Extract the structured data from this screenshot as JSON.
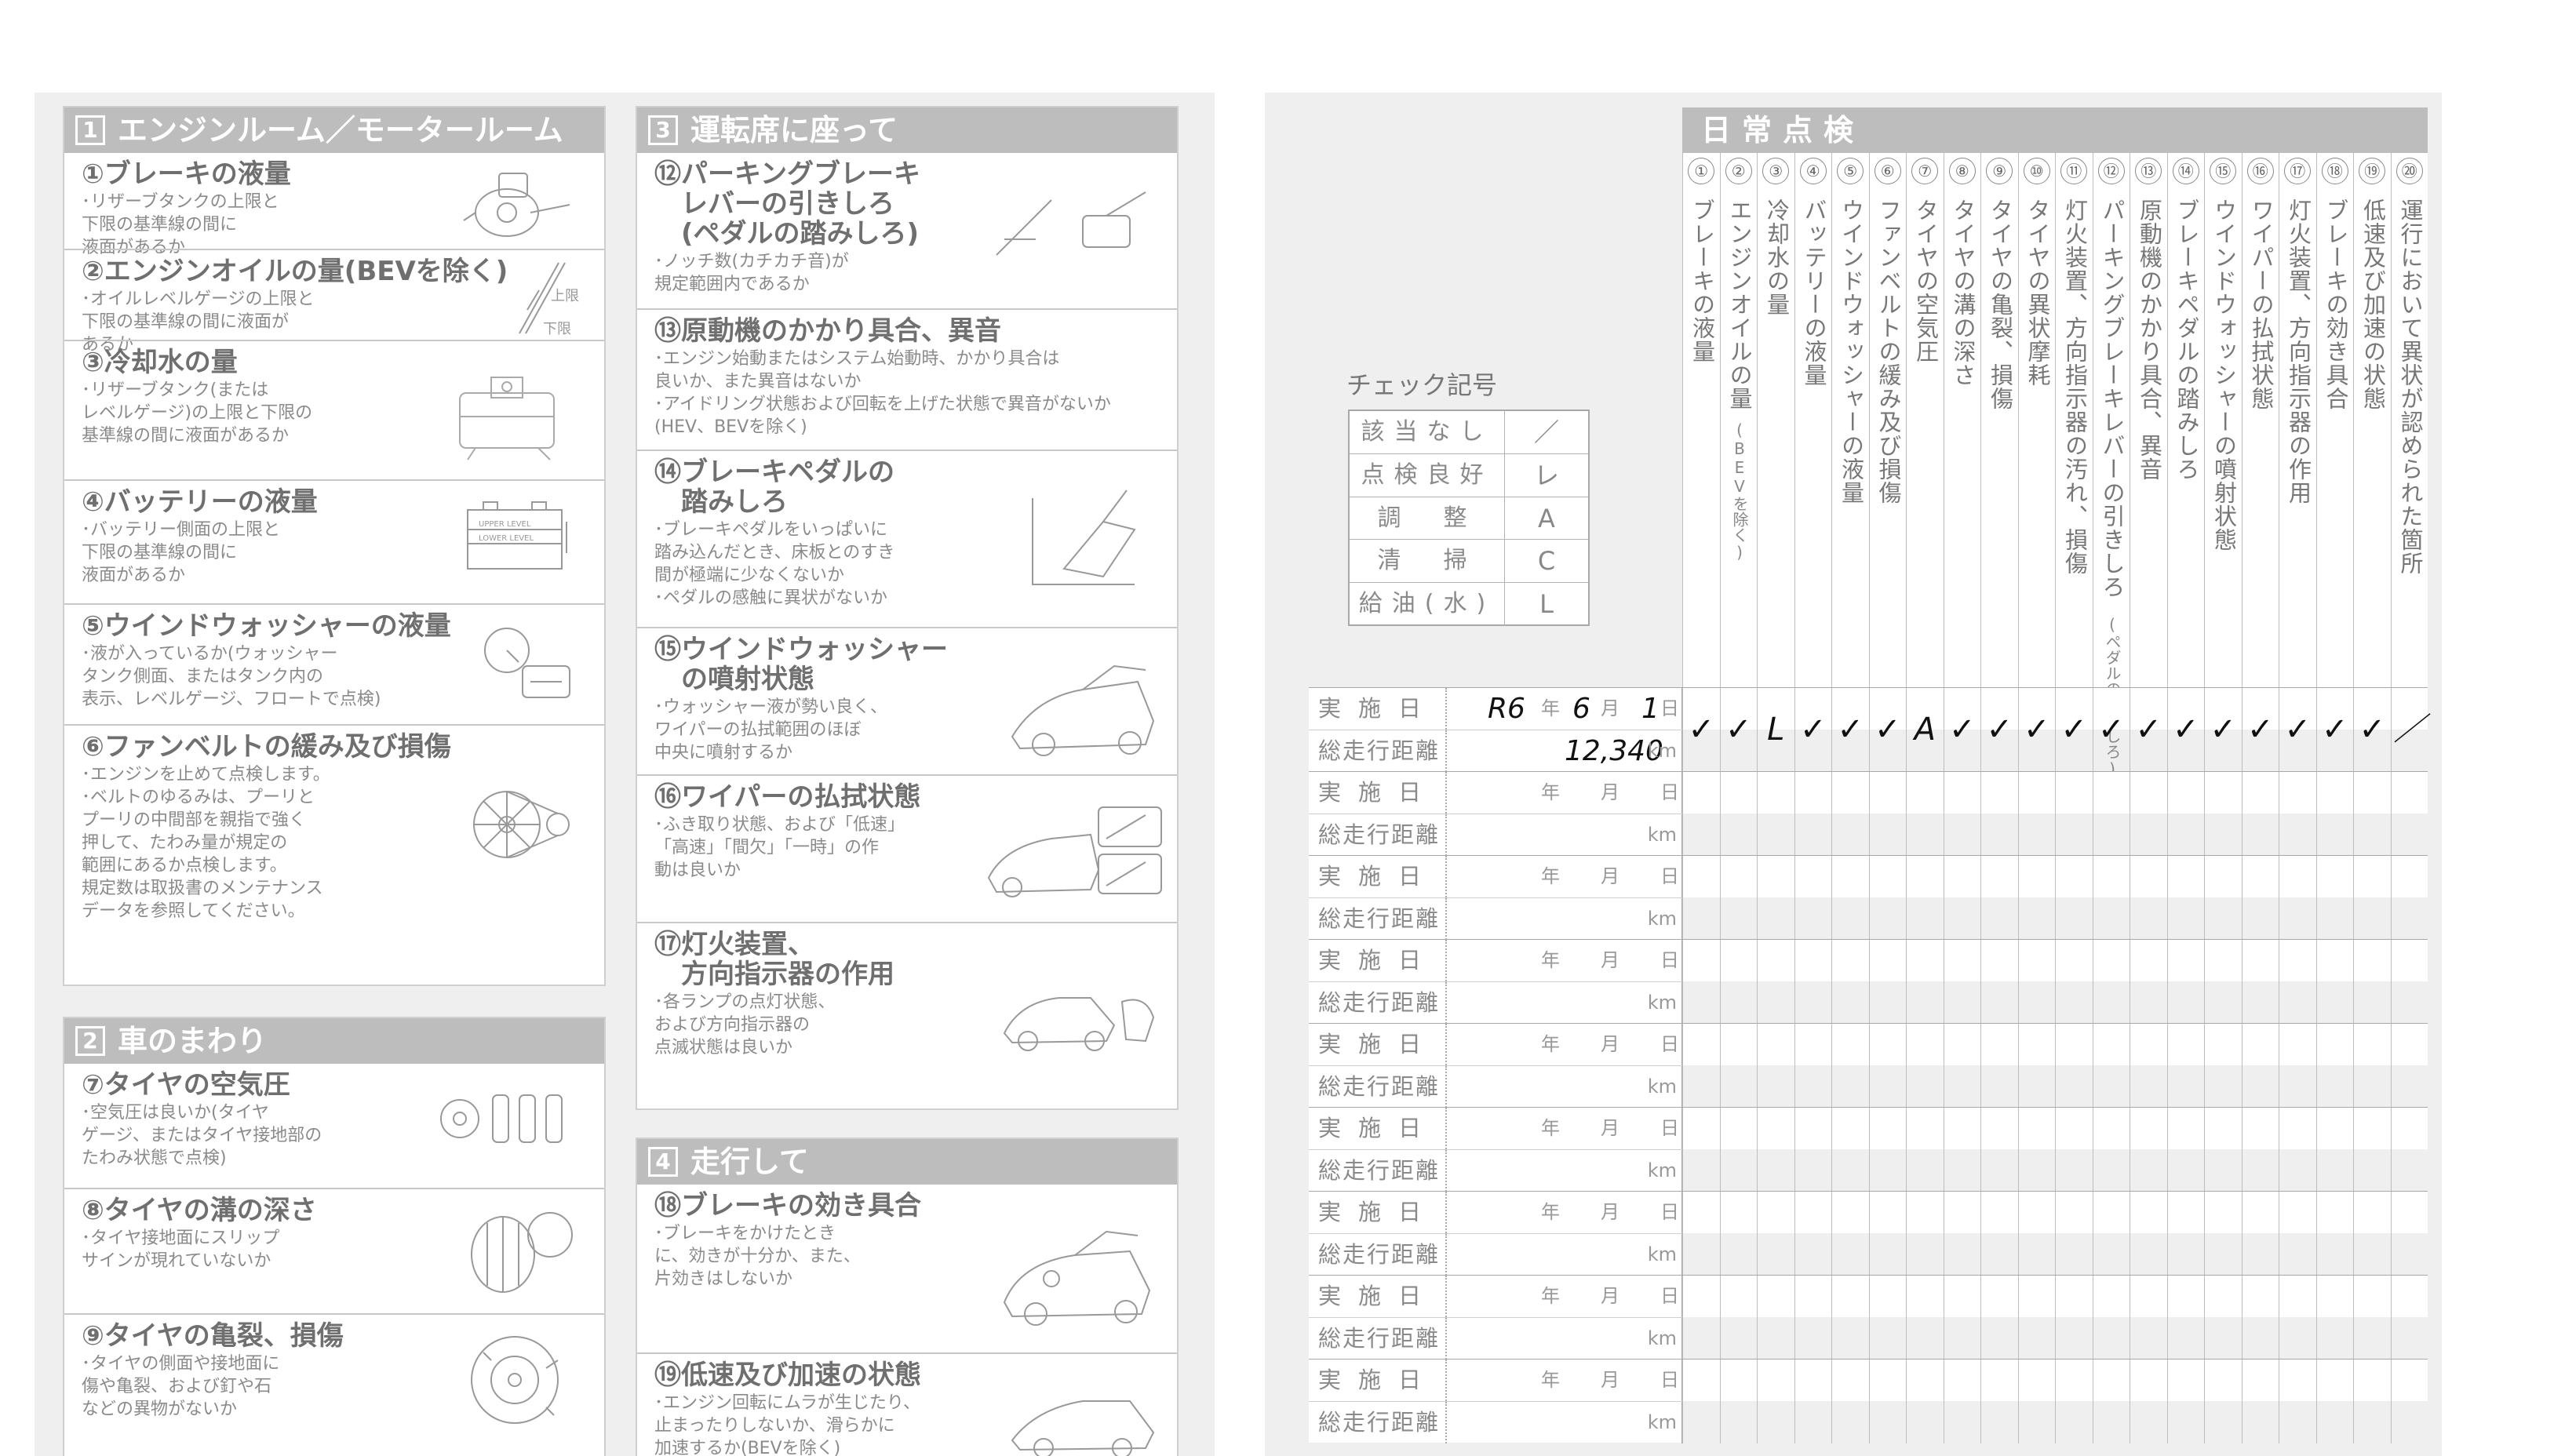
{
  "left": {
    "sections": [
      {
        "num": "1",
        "title": "エンジンルーム／モータールーム",
        "items": [
          {
            "title": "①ブレーキの液量",
            "desc": "･リザーブタンクの上限と\n下限の基準線の間に\n液面があるか"
          },
          {
            "title": "②エンジンオイルの量(BEVを除く)",
            "desc": "･オイルレベルゲージの上限と\n下限の基準線の間に液面が\nあるか",
            "illus_labels": [
              "上限",
              "下限"
            ]
          },
          {
            "title": "③冷却水の量",
            "desc": "･リザーブタンク(または\nレベルゲージ)の上限と下限の\n基準線の間に液面があるか"
          },
          {
            "title": "④バッテリーの液量",
            "desc": "･バッテリー側面の上限と\n下限の基準線の間に\n液面があるか",
            "illus_labels": [
              "UPPER LEVEL",
              "LOWER LEVEL"
            ]
          },
          {
            "title": "⑤ウインドウォッシャーの液量",
            "desc": "･液が入っているか(ウォッシャー\nタンク側面、またはタンク内の\n表示、レベルゲージ、フロートで点検)"
          },
          {
            "title": "⑥ファンベルトの緩み及び損傷",
            "desc": "･エンジンを止めて点検します。\n･ベルトのゆるみは、プーリと\nプーリの中間部を親指で強く\n押して、たわみ量が規定の\n範囲にあるか点検します。\n規定数は取扱書のメンテナンス\nデータを参照してください。"
          }
        ]
      },
      {
        "num": "2",
        "title": "車のまわり",
        "items": [
          {
            "title": "⑦タイヤの空気圧",
            "desc": "･空気圧は良いか(タイヤ\nゲージ、またはタイヤ接地部の\nたわみ状態で点検)"
          },
          {
            "title": "⑧タイヤの溝の深さ",
            "desc": "･タイヤ接地面にスリップ\nサインが現れていないか"
          },
          {
            "title": "⑨タイヤの亀裂、損傷",
            "desc": "･タイヤの側面や接地面に\n傷や亀裂、および釘や石\nなどの異物がないか"
          }
        ]
      },
      {
        "num": "3",
        "title": "運転席に座って",
        "items": [
          {
            "title": "⑫パーキングブレーキ\n　レバーの引きしろ\n　(ペダルの踏みしろ)",
            "desc": "･ノッチ数(カチカチ音)が\n規定範囲内であるか"
          },
          {
            "title": "⑬原動機のかかり具合、異音",
            "desc": "･エンジン始動またはシステム始動時、かかり具合は\n良いか、また異音はないか\n･アイドリング状態および回転を上げた状態で異音がないか\n(HEV、BEVを除く)"
          },
          {
            "title": "⑭ブレーキペダルの\n　踏みしろ",
            "desc": "･ブレーキペダルをいっぱいに\n踏み込んだとき、床板とのすき\n間が極端に少なくないか\n･ペダルの感触に異状がないか"
          },
          {
            "title": "⑮ウインドウォッシャー\n　の噴射状態",
            "desc": "･ウォッシャー液が勢い良く、\nワイパーの払拭範囲のほぼ\n中央に噴射するか"
          },
          {
            "title": "⑯ワイパーの払拭状態",
            "desc": "･ふき取り状態、および「低速」\n「高速」「間欠」「一時」の作\n動は良いか"
          },
          {
            "title": "⑰灯火装置、\n　方向指示器の作用",
            "desc": "･各ランプの点灯状態、\nおよび方向指示器の\n点滅状態は良いか"
          }
        ]
      },
      {
        "num": "4",
        "title": "走行して",
        "items": [
          {
            "title": "⑱ブレーキの効き具合",
            "desc": "･ブレーキをかけたとき\nに、効きが十分か、また、\n片効きはしないか"
          },
          {
            "title": "⑲低速及び加速の状態",
            "desc": "･エンジン回転にムラが生じたり、\n止まったりしないか、滑らかに\n加速するか(BEVを除く)"
          }
        ]
      }
    ]
  },
  "right": {
    "check_marks_title": "チェック記号",
    "check_marks": [
      {
        "label": "該当なし",
        "symbol": "／"
      },
      {
        "label": "点検良好",
        "symbol": "レ"
      },
      {
        "label": "調　整",
        "symbol": "A"
      },
      {
        "label": "清　掃",
        "symbol": "C"
      },
      {
        "label": "給油(水)",
        "symbol": "L"
      }
    ],
    "daily_title": "日常点検",
    "columns": [
      {
        "num": "①",
        "label": "ブレーキの液量"
      },
      {
        "num": "②",
        "label": "エンジンオイルの量",
        "note": "(BEVを除く)"
      },
      {
        "num": "③",
        "label": "冷却水の量"
      },
      {
        "num": "④",
        "label": "バッテリーの液量"
      },
      {
        "num": "⑤",
        "label": "ウインドウォッシャーの液量"
      },
      {
        "num": "⑥",
        "label": "ファンベルトの緩み及び損傷"
      },
      {
        "num": "⑦",
        "label": "タイヤの空気圧"
      },
      {
        "num": "⑧",
        "label": "タイヤの溝の深さ"
      },
      {
        "num": "⑨",
        "label": "タイヤの亀裂、損傷"
      },
      {
        "num": "⑩",
        "label": "タイヤの異状摩耗"
      },
      {
        "num": "⑪",
        "label": "灯火装置、方向指示器の汚れ、損傷"
      },
      {
        "num": "⑫",
        "label": "パーキングブレーキレバーの引きしろ",
        "note": "(ペダルの踏みしろ)"
      },
      {
        "num": "⑬",
        "label": "原動機のかかり具合、異音"
      },
      {
        "num": "⑭",
        "label": "ブレーキペダルの踏みしろ"
      },
      {
        "num": "⑮",
        "label": "ウインドウォッシャーの噴射状態"
      },
      {
        "num": "⑯",
        "label": "ワイパーの払拭状態"
      },
      {
        "num": "⑰",
        "label": "灯火装置、方向指示器の作用"
      },
      {
        "num": "⑱",
        "label": "ブレーキの効き具合"
      },
      {
        "num": "⑲",
        "label": "低速及び加速の状態"
      },
      {
        "num": "⑳",
        "label": "運行において異状が認められた箇所"
      }
    ],
    "labels": {
      "date": "実施日",
      "mileage": "総走行距離",
      "year": "年",
      "month": "月",
      "day": "日",
      "km": "km"
    },
    "records": [
      {
        "era_year": "R6",
        "month": "6",
        "day": "1",
        "mileage": "12,340",
        "marks": [
          "✓",
          "✓",
          "L",
          "✓",
          "✓",
          "✓",
          "A",
          "✓",
          "✓",
          "✓",
          "✓",
          "✓",
          "✓",
          "✓",
          "✓",
          "✓",
          "✓",
          "✓",
          "✓",
          "／"
        ]
      },
      {
        "era_year": "",
        "month": "",
        "day": "",
        "mileage": "",
        "marks": []
      },
      {
        "era_year": "",
        "month": "",
        "day": "",
        "mileage": "",
        "marks": []
      },
      {
        "era_year": "",
        "month": "",
        "day": "",
        "mileage": "",
        "marks": []
      },
      {
        "era_year": "",
        "month": "",
        "day": "",
        "mileage": "",
        "marks": []
      },
      {
        "era_year": "",
        "month": "",
        "day": "",
        "mileage": "",
        "marks": []
      },
      {
        "era_year": "",
        "month": "",
        "day": "",
        "mileage": "",
        "marks": []
      },
      {
        "era_year": "",
        "month": "",
        "day": "",
        "mileage": "",
        "marks": []
      },
      {
        "era_year": "",
        "month": "",
        "day": "",
        "mileage": "",
        "marks": []
      }
    ]
  }
}
